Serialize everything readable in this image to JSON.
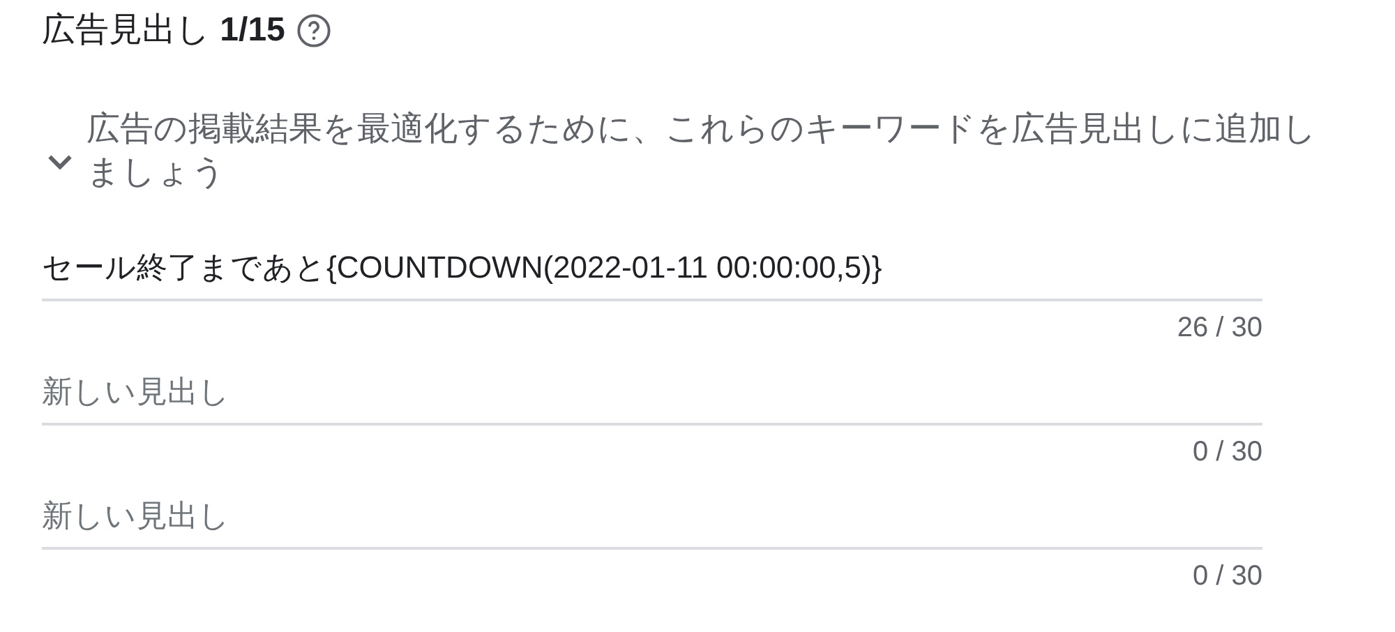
{
  "title": "広告見出し **1/15**",
  "suggestion": {
    "text": "広告の掲載結果を最適化するために、これらのキーワードを広告見出しに追加しましょう",
    "expanded": false
  },
  "fields": [
    {
      "value": "セール終了まであと{COUNTDOWN(2022-01-11 00:00:00,5)}",
      "counter": "26 / 30"
    },
    {
      "placeholder": "新しい見出し",
      "counter": "0 / 30"
    },
    {
      "placeholder": "新しい見出し",
      "counter": "0 / 30"
    }
  ]
}
